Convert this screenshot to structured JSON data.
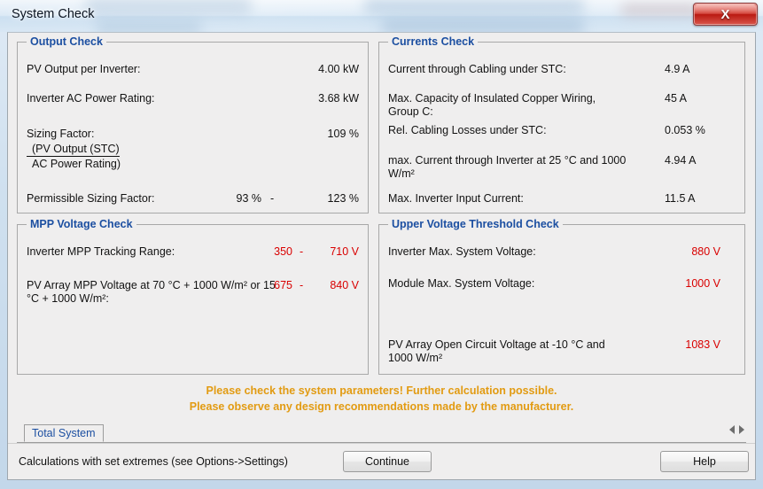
{
  "window": {
    "title": "System Check",
    "close_label": "X",
    "close_icon": "close-icon"
  },
  "panels": {
    "output_check": {
      "legend": "Output Check",
      "rows": [
        {
          "label": "PV Output per Inverter:",
          "value": "4.00 kW"
        },
        {
          "label": "Inverter AC Power Rating:",
          "value": "3.68 kW"
        },
        {
          "label": "Sizing Factor:",
          "value": "109 %"
        }
      ],
      "fraction": {
        "numerator": "(PV Output (STC)",
        "denominator": "AC Power Rating)"
      },
      "permissible": {
        "label": "Permissible Sizing Factor:",
        "min": "93 %",
        "separator": "-",
        "max": "123 %"
      }
    },
    "currents_check": {
      "legend": "Currents Check",
      "rows": [
        {
          "label": "Current through Cabling under STC:",
          "value": "4.9 A"
        },
        {
          "label": "Max. Capacity of Insulated Copper Wiring, Group C:",
          "value": "45 A"
        },
        {
          "label": "Rel. Cabling Losses under STC:",
          "value": "0.053 %"
        },
        {
          "label": "max. Current through Inverter at 25 °C and 1000 W/m²",
          "value": "4.94 A"
        },
        {
          "label": "Max. Inverter Input Current:",
          "value": "11.5 A"
        }
      ]
    },
    "mpp_voltage_check": {
      "legend": "MPP Voltage Check",
      "rows": [
        {
          "label": "Inverter MPP Tracking Range:",
          "min": "350",
          "separator": "-",
          "max": "710 V"
        },
        {
          "label": "PV Array MPP Voltage at 70 °C + 1000 W/m² or 15 °C + 1000 W/m²:",
          "min": "675",
          "separator": "-",
          "max": "840 V"
        }
      ]
    },
    "upper_voltage_threshold_check": {
      "legend": "Upper Voltage Threshold Check",
      "rows": [
        {
          "label": "Inverter Max. System Voltage:",
          "value": "880 V"
        },
        {
          "label": "Module Max. System Voltage:",
          "value": "1000 V"
        },
        {
          "label": "PV Array Open Circuit Voltage at -10 °C and 1000 W/m²",
          "value": "1083 V"
        }
      ]
    }
  },
  "warning": {
    "line1": "Please check the system parameters! Further calculation possible.",
    "line2": "Please observe any design recommendations made by the manufacturer."
  },
  "tabs": {
    "items": [
      {
        "label": "Total System"
      }
    ],
    "scroll_left_icon": "chevron-left-icon",
    "scroll_right_icon": "chevron-right-icon"
  },
  "footer": {
    "note": "Calculations with set extremes (see Options->Settings)",
    "continue_label": "Continue",
    "help_label": "Help"
  },
  "colors": {
    "legend_blue": "#1c4fa1",
    "value_red": "#d90000",
    "warning_orange": "#e29b12",
    "close_red": "#ba1a12"
  }
}
